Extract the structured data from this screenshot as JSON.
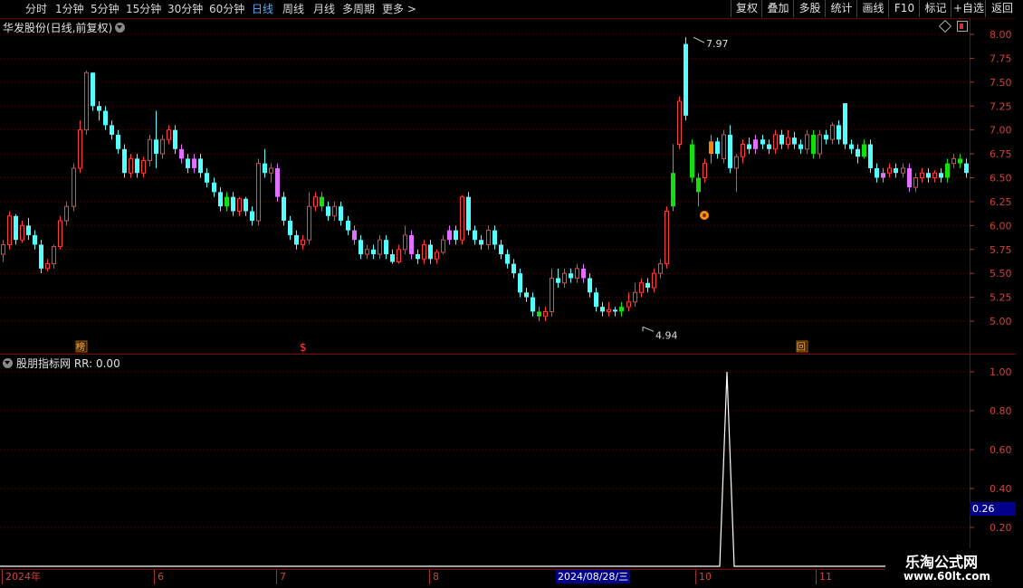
{
  "toolbar": {
    "periods": [
      "分时",
      "1分钟",
      "5分钟",
      "15分钟",
      "30分钟",
      "60分钟",
      "日线",
      "周线",
      "月线",
      "多周期",
      "更多 >"
    ],
    "active_period": "日线",
    "buttons": [
      "复权",
      "叠加",
      "多股",
      "统计",
      "画线",
      "F10",
      "标记",
      "+自选",
      "返回"
    ]
  },
  "main_title": "华发股份(日线,前复权)",
  "indicator_title": "股朋指标网 RR: 0.00",
  "markers": {
    "bang": "榜",
    "dollar": "$",
    "hui": "回"
  },
  "price_axis_ticks": [
    "8.00",
    "7.75",
    "7.50",
    "7.25",
    "7.00",
    "6.75",
    "6.50",
    "6.25",
    "6.00",
    "5.75",
    "5.50",
    "5.25",
    "5.00"
  ],
  "indicator_axis_ticks": [
    "1.00",
    "0.80",
    "0.60",
    "0.40",
    "0.20"
  ],
  "indicator_current": "0.26",
  "annotations": {
    "high": "7.97",
    "low": "4.94"
  },
  "time_axis": {
    "labels": [
      "2024年",
      "6",
      "7",
      "8",
      "10",
      "11"
    ],
    "cursor": "2024/08/28/三"
  },
  "watermark": {
    "name": "乐淘公式网",
    "url": "www.60lt.com"
  },
  "colors": {
    "up": "#ff3b3b",
    "down": "#54ffff",
    "magenta": "#e070ff",
    "green": "#10e010",
    "orange": "#ff8000"
  },
  "chart_data": {
    "type": "candlestick",
    "ylim": [
      4.85,
      8.05
    ],
    "candles": [
      [
        5.7,
        5.8,
        5.62,
        5.85
      ],
      [
        5.8,
        6.1,
        5.75,
        6.15
      ],
      [
        6.1,
        5.85,
        5.8,
        6.12
      ],
      [
        5.85,
        6.0,
        5.82,
        6.05
      ],
      [
        6.0,
        5.9,
        5.85,
        6.08
      ],
      [
        5.9,
        5.8,
        5.75,
        5.95
      ],
      [
        5.8,
        5.55,
        5.5,
        5.85
      ],
      [
        5.55,
        5.6,
        5.52,
        5.65
      ],
      [
        5.6,
        5.78,
        5.55,
        5.8
      ],
      [
        5.78,
        6.05,
        5.75,
        6.1
      ],
      [
        6.05,
        6.2,
        6.0,
        6.25
      ],
      [
        6.2,
        6.6,
        6.15,
        6.65
      ],
      [
        6.6,
        7.0,
        6.55,
        7.1
      ],
      [
        7.0,
        7.6,
        6.95,
        7.62
      ],
      [
        7.6,
        7.25,
        7.2,
        7.6
      ],
      [
        7.25,
        7.2,
        7.1,
        7.3
      ],
      [
        7.2,
        7.05,
        7.0,
        7.25
      ],
      [
        7.05,
        6.95,
        6.9,
        7.1
      ],
      [
        6.95,
        6.8,
        6.75,
        7.0
      ],
      [
        6.8,
        6.55,
        6.5,
        6.85
      ],
      [
        6.55,
        6.7,
        6.5,
        6.75
      ],
      [
        6.7,
        6.55,
        6.5,
        6.75
      ],
      [
        6.55,
        6.68,
        6.5,
        6.72
      ],
      [
        6.68,
        6.9,
        6.62,
        6.95
      ],
      [
        6.9,
        6.75,
        6.6,
        7.2
      ],
      [
        6.75,
        6.9,
        6.7,
        6.95
      ],
      [
        6.9,
        7.0,
        6.85,
        7.05
      ],
      [
        7.0,
        6.8,
        6.75,
        7.05
      ],
      [
        6.8,
        6.7,
        6.65,
        6.85
      ],
      [
        6.7,
        6.6,
        6.55,
        6.75
      ],
      [
        6.6,
        6.7,
        6.55,
        6.75
      ],
      [
        6.7,
        6.55,
        6.5,
        6.75
      ],
      [
        6.55,
        6.45,
        6.4,
        6.6
      ],
      [
        6.45,
        6.35,
        6.3,
        6.5
      ],
      [
        6.35,
        6.2,
        6.15,
        6.4
      ],
      [
        6.2,
        6.3,
        6.15,
        6.35
      ],
      [
        6.3,
        6.15,
        6.1,
        6.35
      ],
      [
        6.15,
        6.28,
        6.1,
        6.3
      ],
      [
        6.28,
        6.15,
        6.1,
        6.3
      ],
      [
        6.15,
        6.05,
        6.0,
        6.2
      ],
      [
        6.05,
        6.65,
        6.0,
        6.7
      ],
      [
        6.65,
        6.55,
        6.5,
        6.8
      ],
      [
        6.55,
        6.6,
        6.45,
        6.65
      ],
      [
        6.6,
        6.3,
        6.25,
        6.65
      ],
      [
        6.3,
        6.05,
        6.0,
        6.35
      ],
      [
        6.05,
        5.9,
        5.85,
        6.1
      ],
      [
        5.9,
        5.8,
        5.75,
        5.95
      ],
      [
        5.8,
        5.85,
        5.75,
        5.9
      ],
      [
        5.85,
        6.2,
        5.8,
        6.35
      ],
      [
        6.2,
        6.3,
        6.15,
        6.35
      ],
      [
        6.3,
        6.2,
        6.15,
        6.35
      ],
      [
        6.2,
        6.1,
        6.05,
        6.25
      ],
      [
        6.1,
        6.2,
        6.05,
        6.25
      ],
      [
        6.2,
        6.05,
        6.0,
        6.25
      ],
      [
        6.05,
        5.95,
        5.9,
        6.1
      ],
      [
        5.95,
        5.85,
        5.8,
        6.0
      ],
      [
        5.85,
        5.7,
        5.65,
        5.9
      ],
      [
        5.7,
        5.75,
        5.65,
        5.8
      ],
      [
        5.75,
        5.7,
        5.65,
        5.8
      ],
      [
        5.7,
        5.85,
        5.65,
        5.9
      ],
      [
        5.85,
        5.7,
        5.65,
        5.9
      ],
      [
        5.7,
        5.62,
        5.6,
        5.75
      ],
      [
        5.62,
        5.75,
        5.6,
        5.8
      ],
      [
        5.75,
        5.9,
        5.7,
        6.0
      ],
      [
        5.9,
        5.7,
        5.65,
        5.95
      ],
      [
        5.7,
        5.65,
        5.6,
        5.75
      ],
      [
        5.65,
        5.8,
        5.6,
        5.85
      ],
      [
        5.8,
        5.65,
        5.6,
        5.85
      ],
      [
        5.65,
        5.72,
        5.6,
        5.75
      ],
      [
        5.72,
        5.85,
        5.7,
        5.9
      ],
      [
        5.85,
        5.95,
        5.8,
        6.0
      ],
      [
        5.95,
        5.85,
        5.8,
        6.0
      ],
      [
        5.85,
        6.3,
        5.8,
        6.32
      ],
      [
        6.3,
        5.95,
        5.9,
        6.35
      ],
      [
        5.95,
        5.85,
        5.8,
        6.0
      ],
      [
        5.85,
        5.8,
        5.75,
        5.9
      ],
      [
        5.8,
        5.95,
        5.75,
        6.0
      ],
      [
        5.95,
        5.8,
        5.75,
        6.0
      ],
      [
        5.8,
        5.7,
        5.65,
        5.85
      ],
      [
        5.7,
        5.6,
        5.55,
        5.75
      ],
      [
        5.6,
        5.5,
        5.45,
        5.65
      ],
      [
        5.5,
        5.3,
        5.25,
        5.55
      ],
      [
        5.3,
        5.25,
        5.2,
        5.35
      ],
      [
        5.25,
        5.1,
        5.05,
        5.3
      ],
      [
        5.1,
        5.05,
        5.0,
        5.15
      ],
      [
        5.05,
        5.1,
        5.0,
        5.15
      ],
      [
        5.1,
        5.45,
        5.05,
        5.55
      ],
      [
        5.45,
        5.4,
        5.35,
        5.55
      ],
      [
        5.4,
        5.5,
        5.35,
        5.55
      ],
      [
        5.5,
        5.45,
        5.4,
        5.55
      ],
      [
        5.45,
        5.55,
        5.4,
        5.6
      ],
      [
        5.55,
        5.45,
        5.4,
        5.6
      ],
      [
        5.45,
        5.3,
        5.25,
        5.5
      ],
      [
        5.3,
        5.15,
        5.1,
        5.35
      ],
      [
        5.15,
        5.1,
        5.05,
        5.2
      ],
      [
        5.1,
        5.12,
        5.05,
        5.2
      ],
      [
        5.12,
        5.1,
        5.05,
        5.15
      ],
      [
        5.1,
        5.15,
        5.05,
        5.2
      ],
      [
        5.15,
        5.2,
        5.1,
        5.3
      ],
      [
        5.2,
        5.3,
        5.15,
        5.4
      ],
      [
        5.3,
        5.4,
        5.25,
        5.45
      ],
      [
        5.4,
        5.35,
        5.3,
        5.45
      ],
      [
        5.35,
        5.5,
        5.3,
        5.55
      ],
      [
        5.5,
        5.6,
        5.45,
        5.65
      ],
      [
        5.6,
        6.15,
        5.55,
        6.2
      ],
      [
        6.2,
        6.55,
        6.15,
        6.85
      ],
      [
        6.85,
        7.3,
        6.8,
        7.35
      ],
      [
        7.9,
        7.15,
        7.1,
        7.97
      ],
      [
        6.85,
        6.5,
        6.45,
        6.9
      ],
      [
        6.5,
        6.35,
        6.2,
        6.55
      ],
      [
        6.5,
        6.65,
        6.45,
        6.7
      ],
      [
        6.75,
        6.88,
        6.65,
        6.95
      ],
      [
        6.88,
        6.75,
        6.7,
        6.92
      ],
      [
        6.7,
        6.95,
        6.65,
        7.0
      ],
      [
        6.95,
        6.6,
        6.55,
        7.05
      ],
      [
        6.6,
        6.72,
        6.35,
        6.75
      ],
      [
        6.72,
        6.85,
        6.65,
        6.9
      ],
      [
        6.85,
        6.8,
        6.75,
        6.92
      ],
      [
        6.8,
        6.9,
        6.75,
        6.95
      ],
      [
        6.9,
        6.85,
        6.8,
        6.95
      ],
      [
        6.85,
        6.8,
        6.75,
        6.9
      ],
      [
        6.8,
        6.95,
        6.75,
        7.0
      ],
      [
        6.95,
        6.85,
        6.8,
        7.0
      ],
      [
        6.85,
        6.92,
        6.8,
        7.0
      ],
      [
        6.92,
        6.85,
        6.8,
        6.98
      ],
      [
        6.85,
        6.8,
        6.75,
        6.9
      ],
      [
        6.8,
        6.95,
        6.75,
        7.0
      ],
      [
        6.95,
        6.75,
        6.7,
        7.0
      ],
      [
        6.75,
        6.95,
        6.7,
        7.0
      ],
      [
        6.95,
        6.9,
        6.85,
        7.0
      ],
      [
        6.9,
        7.05,
        6.85,
        7.08
      ],
      [
        7.05,
        6.9,
        6.85,
        7.1
      ],
      [
        7.28,
        6.85,
        6.8,
        7.28
      ],
      [
        6.85,
        6.8,
        6.75,
        6.9
      ],
      [
        6.8,
        6.72,
        6.65,
        6.85
      ],
      [
        6.72,
        6.85,
        6.7,
        6.9
      ],
      [
        6.85,
        6.6,
        6.55,
        6.9
      ],
      [
        6.6,
        6.5,
        6.45,
        6.65
      ],
      [
        6.5,
        6.55,
        6.45,
        6.6
      ],
      [
        6.55,
        6.6,
        6.5,
        6.65
      ],
      [
        6.6,
        6.55,
        6.5,
        6.65
      ],
      [
        6.55,
        6.6,
        6.5,
        6.65
      ],
      [
        6.6,
        6.4,
        6.35,
        6.65
      ],
      [
        6.4,
        6.5,
        6.35,
        6.55
      ],
      [
        6.5,
        6.55,
        6.45,
        6.6
      ],
      [
        6.55,
        6.5,
        6.45,
        6.6
      ],
      [
        6.5,
        6.55,
        6.45,
        6.58
      ],
      [
        6.55,
        6.5,
        6.45,
        6.6
      ],
      [
        6.5,
        6.65,
        6.45,
        6.7
      ],
      [
        6.65,
        6.7,
        6.6,
        6.75
      ],
      [
        6.7,
        6.65,
        6.6,
        6.75
      ],
      [
        6.65,
        6.55,
        6.5,
        6.7
      ]
    ],
    "indicator": {
      "name": "RR",
      "spike_at": 113,
      "spike_value": 1.0
    }
  }
}
